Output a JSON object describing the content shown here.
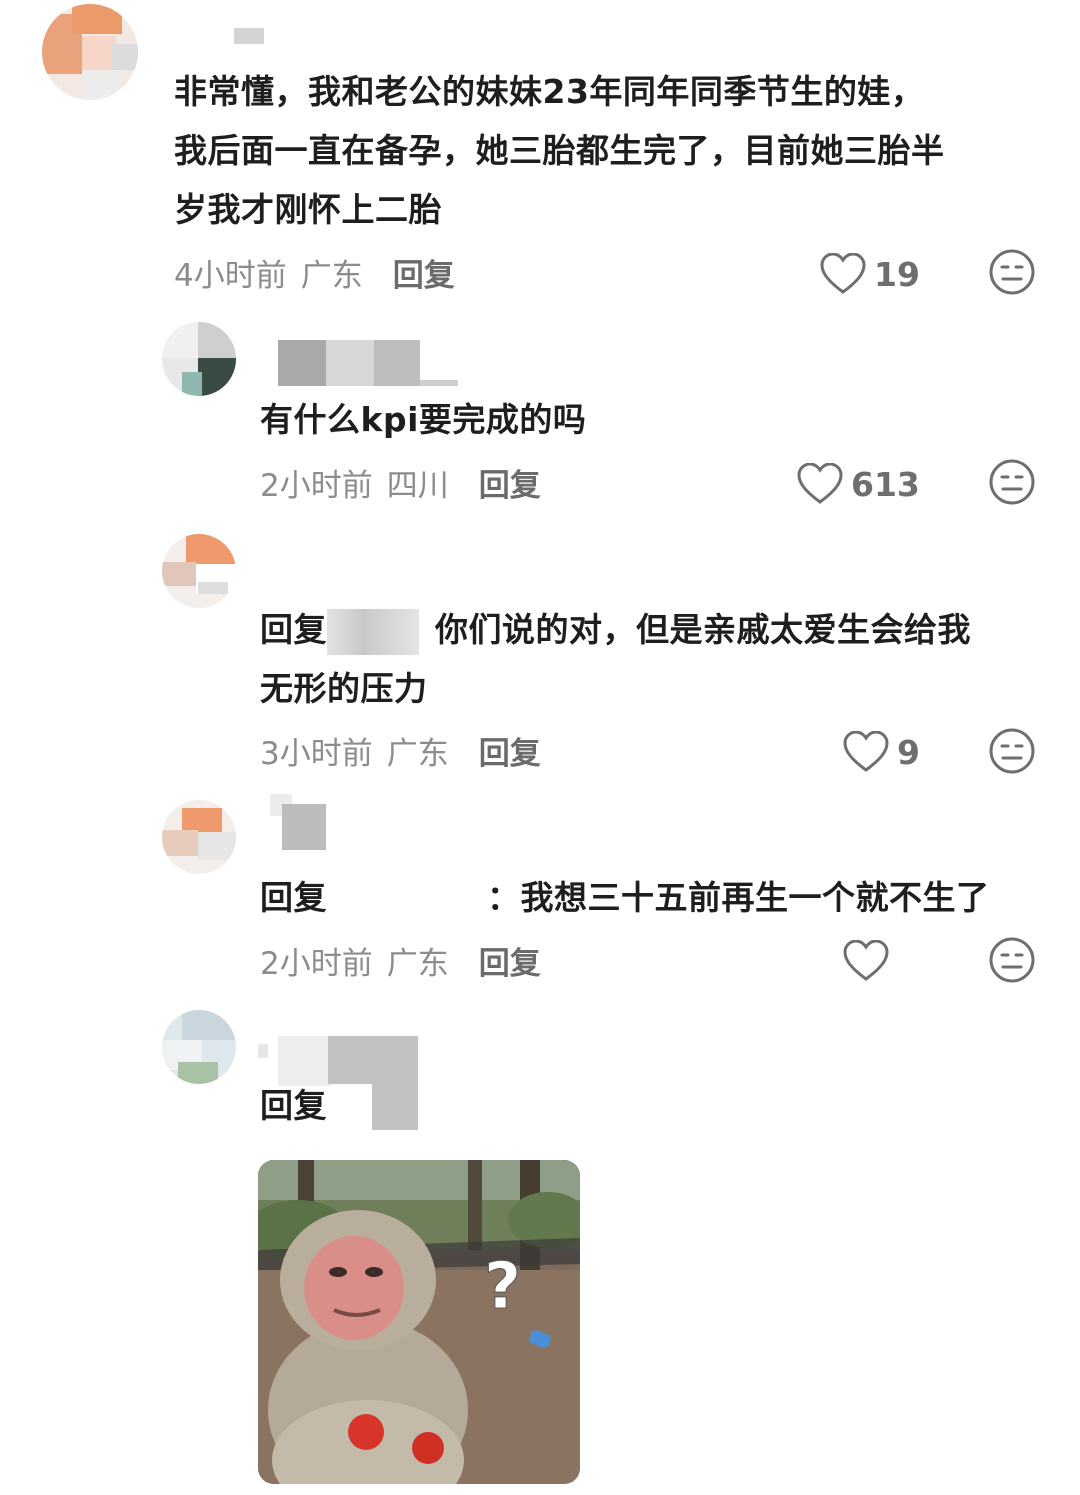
{
  "comments": [
    {
      "text_lines": [
        "非常懂，我和老公的妹妹23年同年同季节生的娃，",
        "我后面一直在备孕，她三胎都生完了，目前她三胎半",
        "岁我才刚怀上二胎"
      ],
      "time": "4小时前",
      "location": "广东",
      "reply_label": "回复",
      "likes": "19"
    },
    {
      "text": "有什么kpi要完成的吗",
      "time": "2小时前",
      "location": "四川",
      "reply_label": "回复",
      "likes": "613"
    },
    {
      "reply_prefix": "回复",
      "text_line1": "你们说的对，但是亲戚太爱生会给我",
      "text_line2": "无形的压力",
      "time": "3小时前",
      "location": "广东",
      "reply_label": "回复",
      "likes": "9"
    },
    {
      "reply_prefix": "回复",
      "text": "：我想三十五前再生一个就不生了",
      "time": "2小时前",
      "location": "广东",
      "reply_label": "回复",
      "likes": ""
    },
    {
      "reply_prefix": "回复",
      "sticker_label": "?"
    }
  ],
  "colors": {
    "text": "#1e1e1e",
    "meta": "#8c8c8c",
    "icon": "#6e6e6e"
  },
  "icons": [
    "heart-icon",
    "neutral-face-icon"
  ]
}
